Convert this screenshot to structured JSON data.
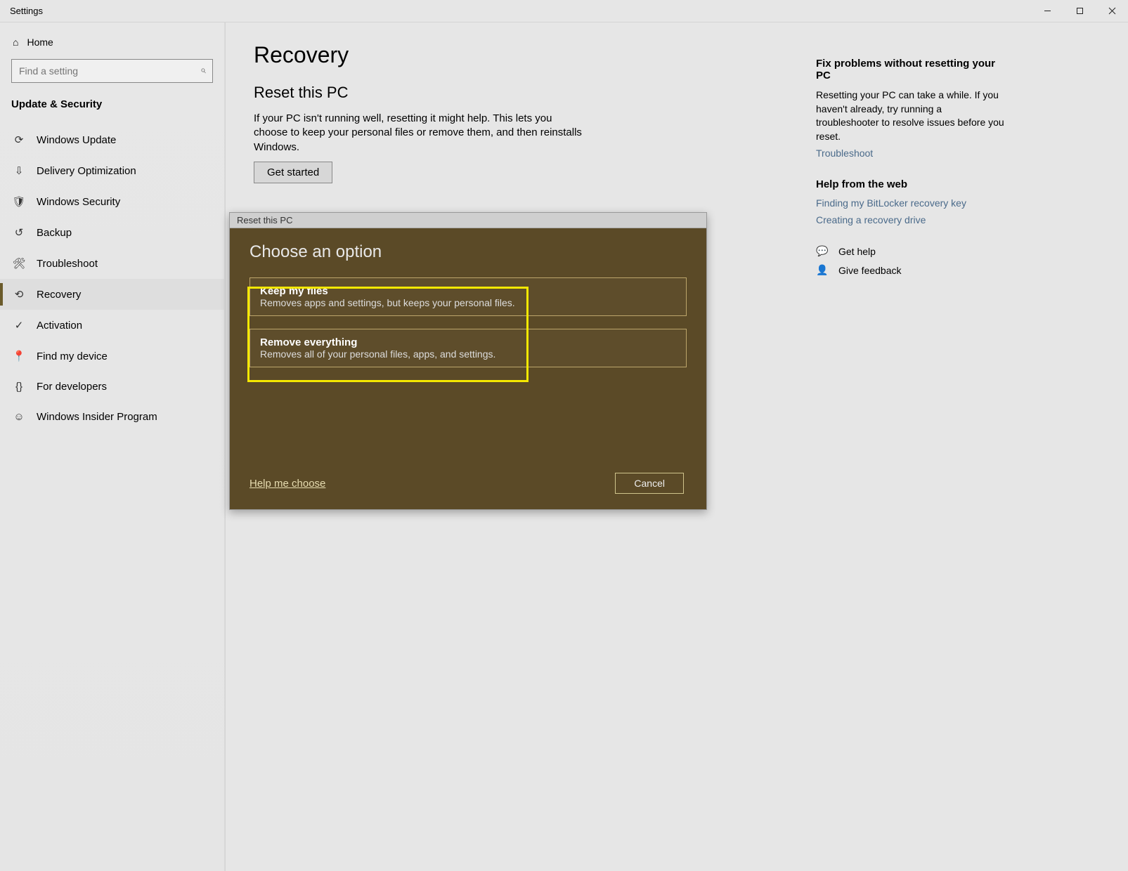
{
  "window": {
    "title": "Settings"
  },
  "sidebar": {
    "home": "Home",
    "search_placeholder": "Find a setting",
    "category": "Update & Security",
    "items": [
      {
        "label": "Windows Update"
      },
      {
        "label": "Delivery Optimization"
      },
      {
        "label": "Windows Security"
      },
      {
        "label": "Backup"
      },
      {
        "label": "Troubleshoot"
      },
      {
        "label": "Recovery"
      },
      {
        "label": "Activation"
      },
      {
        "label": "Find my device"
      },
      {
        "label": "For developers"
      },
      {
        "label": "Windows Insider Program"
      }
    ]
  },
  "page": {
    "title": "Recovery",
    "reset_heading": "Reset this PC",
    "reset_desc": "If your PC isn't running well, resetting it might help. This lets you choose to keep your personal files or remove them, and then reinstalls Windows.",
    "get_started": "Get started"
  },
  "right": {
    "fix_title": "Fix problems without resetting your PC",
    "fix_desc": "Resetting your PC can take a while. If you haven't already, try running a troubleshooter to resolve issues before you reset.",
    "troubleshoot_link": "Troubleshoot",
    "help_title": "Help from the web",
    "link1": "Finding my BitLocker recovery key",
    "link2": "Creating a recovery drive",
    "get_help": "Get help",
    "give_feedback": "Give feedback"
  },
  "modal": {
    "titlebar": "Reset this PC",
    "heading": "Choose an option",
    "opt1_title": "Keep my files",
    "opt1_desc": "Removes apps and settings, but keeps your personal files.",
    "opt2_title": "Remove everything",
    "opt2_desc": "Removes all of your personal files, apps, and settings.",
    "help_link": "Help me choose",
    "cancel": "Cancel"
  }
}
